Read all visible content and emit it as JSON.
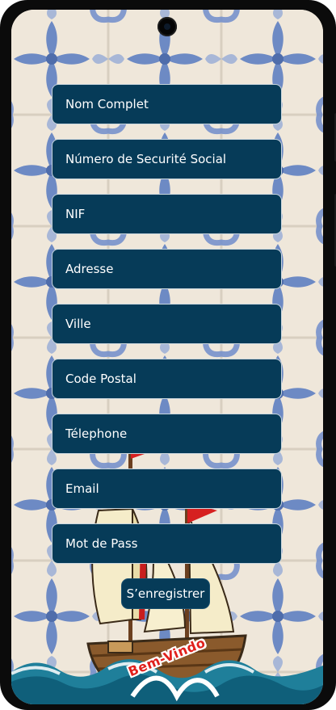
{
  "form": {
    "fields": [
      {
        "placeholder": "Nom Complet",
        "value": ""
      },
      {
        "placeholder": "Número de Securité Social",
        "value": ""
      },
      {
        "placeholder": "NIF",
        "value": ""
      },
      {
        "placeholder": "Adresse",
        "value": ""
      },
      {
        "placeholder": "Ville",
        "value": ""
      },
      {
        "placeholder": "Code Postal",
        "value": ""
      },
      {
        "placeholder": "Télephone",
        "value": ""
      },
      {
        "placeholder": "Email",
        "value": ""
      },
      {
        "placeholder": "Mot de Pass",
        "value": ""
      }
    ],
    "submit_label": "S’enregistrer"
  },
  "banner": {
    "text": "Bem-Vindo"
  },
  "colors": {
    "field_bg": "#063b58",
    "tile_blue": "#5f7fc2",
    "tile_base": "#efe7da",
    "banner_red": "#e0201c"
  }
}
